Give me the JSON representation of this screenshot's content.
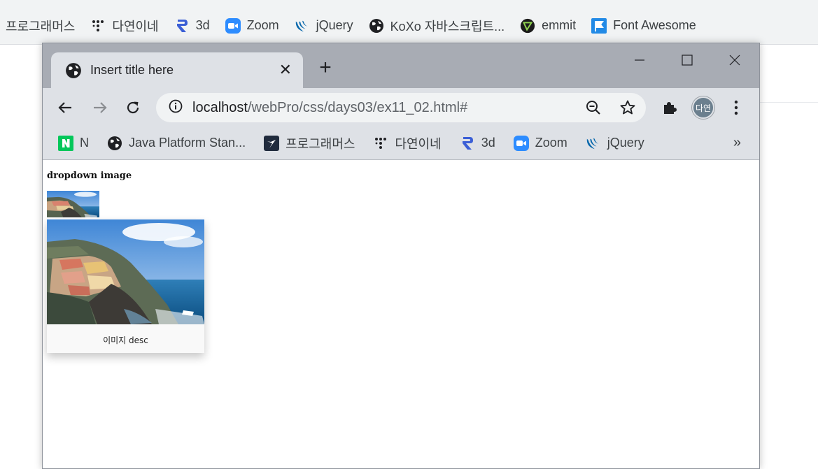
{
  "background_browser": {
    "bookmarks": [
      {
        "label": "프로그래머스",
        "icon": "none"
      },
      {
        "label": "다연이네",
        "icon": "dots-logo-icon"
      },
      {
        "label": "3d",
        "icon": "r-logo-icon"
      },
      {
        "label": "Zoom",
        "icon": "zoom-icon"
      },
      {
        "label": "jQuery",
        "icon": "jquery-icon"
      },
      {
        "label": "KoXo 자바스크립트...",
        "icon": "globe-icon"
      },
      {
        "label": "emmit",
        "icon": "emmet-icon"
      },
      {
        "label": "Font Awesome",
        "icon": "flag-icon"
      }
    ]
  },
  "window": {
    "tab_title": "Insert title here",
    "url_host": "localhost",
    "url_path": "/webPro/css/days03/ex11_02.html#",
    "avatar_text": "다연",
    "bookmarks": [
      {
        "label": "N",
        "icon": "naver-icon"
      },
      {
        "label": "Java Platform Stan...",
        "icon": "globe-icon"
      },
      {
        "label": "프로그래머스",
        "icon": "programmers-icon"
      },
      {
        "label": "다연이네",
        "icon": "dots-logo-icon"
      },
      {
        "label": "3d",
        "icon": "r-logo-icon"
      },
      {
        "label": "Zoom",
        "icon": "zoom-icon"
      },
      {
        "label": "jQuery",
        "icon": "jquery-icon"
      }
    ],
    "bookmarks_more": "»"
  },
  "page": {
    "heading": "dropdown image",
    "dropdown_desc": "이미지 desc"
  },
  "colors": {
    "titlebar": "#a8acb4",
    "toolbar": "#dee1e6",
    "zoom_blue": "#2d8cff",
    "jquery_blue": "#0868ac",
    "fontawesome_blue": "#228ae6",
    "naver_green": "#03c75a"
  }
}
